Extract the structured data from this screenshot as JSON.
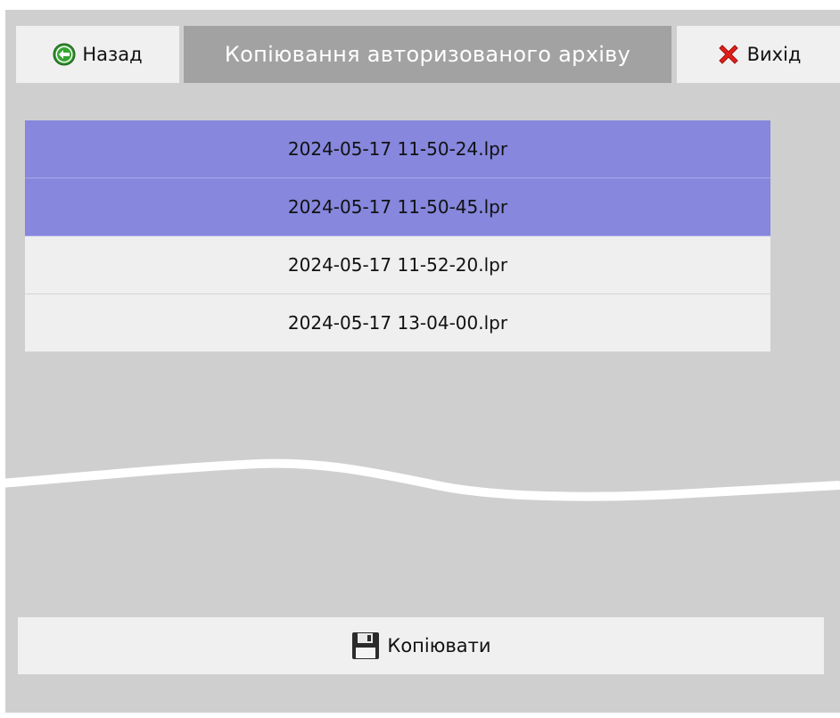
{
  "header": {
    "back_label": "Назад",
    "title": "Копіювання авторизованого архіву",
    "exit_label": "Вихід"
  },
  "files": [
    {
      "name": "2024-05-17 11-50-24.lpr",
      "selected": true
    },
    {
      "name": "2024-05-17 11-50-45.lpr",
      "selected": true
    },
    {
      "name": "2024-05-17 11-52-20.lpr",
      "selected": false
    },
    {
      "name": "2024-05-17 13-04-00.lpr",
      "selected": false
    }
  ],
  "actions": {
    "copy_label": "Копіювати"
  },
  "icons": {
    "back": "arrow-left-circle-icon",
    "exit": "red-x-icon",
    "copy": "floppy-disk-icon"
  },
  "colors": {
    "selected_row": "#8687dd",
    "panel_bg": "#cfcfcf",
    "title_bg": "#a2a2a2"
  }
}
